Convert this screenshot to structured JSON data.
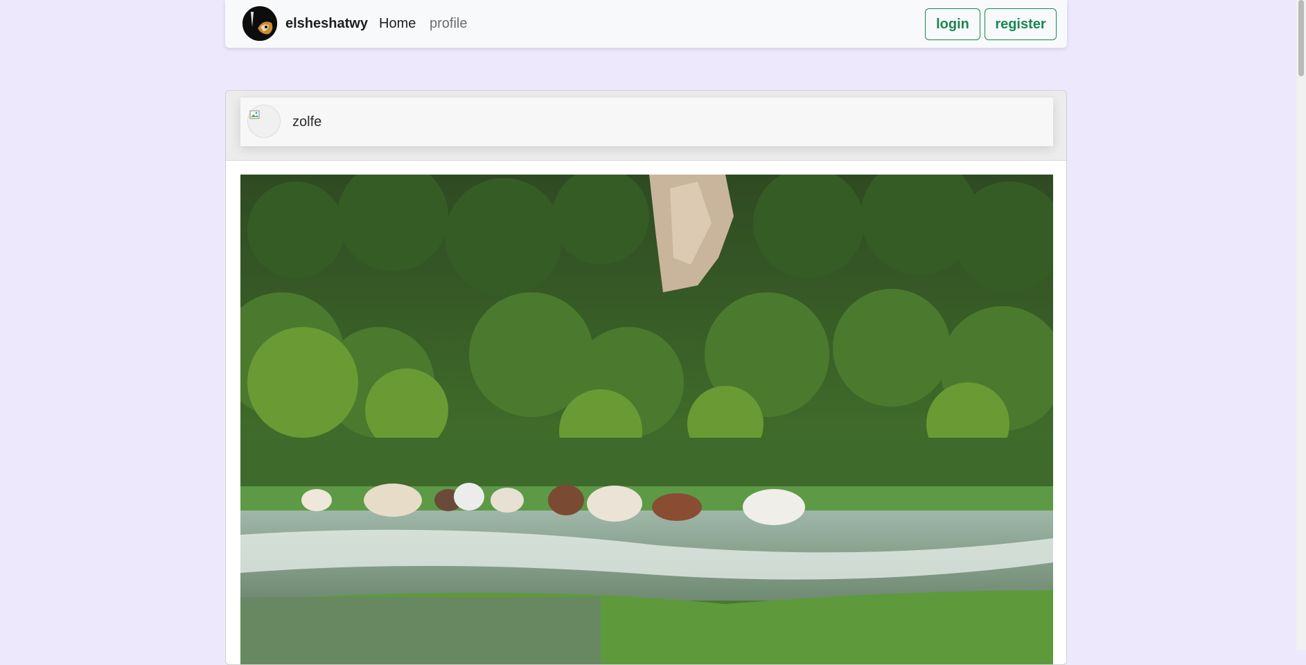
{
  "navbar": {
    "brand_name": "elsheshatwy",
    "links": {
      "home": "Home",
      "profile": "profile"
    },
    "buttons": {
      "login": "login",
      "register": "register"
    },
    "accent_color": "#198754"
  },
  "post": {
    "username": "zolfe",
    "avatar": "broken-image-icon",
    "image": "horses-running-through-water-photo"
  },
  "colors": {
    "page_background": "#eee8fd",
    "navbar_background": "#f8f9fa"
  }
}
